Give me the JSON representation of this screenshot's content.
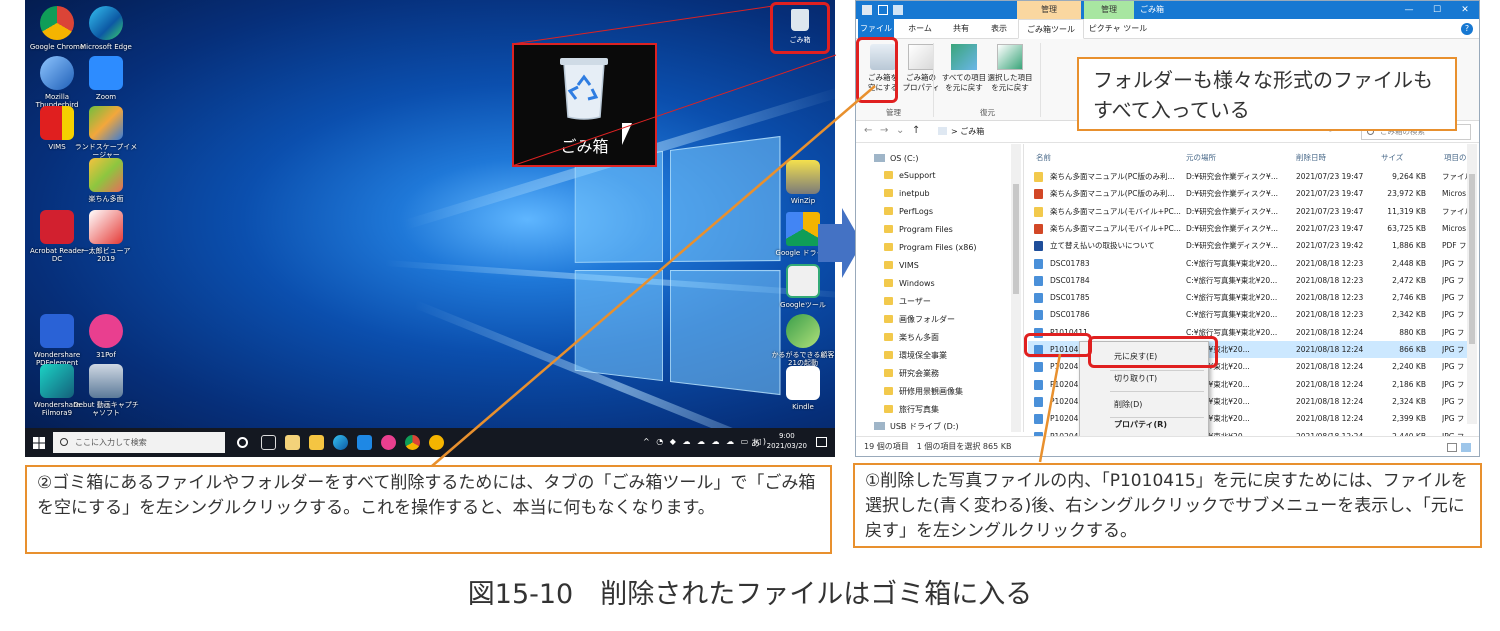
{
  "desktop": {
    "icons": [
      {
        "label": "Google Chrome"
      },
      {
        "label": "Microsoft Edge"
      },
      {
        "label": "Mozilla Thunderbird"
      },
      {
        "label": "Zoom"
      },
      {
        "label": "VIMS"
      },
      {
        "label": "ランドスケープイメージャー"
      },
      {
        "label": "楽ちん多面"
      },
      {
        "label": "Acrobat Reader DC"
      },
      {
        "label": "一太郎ビューア2019"
      },
      {
        "label": "Wondershare PDFelement"
      },
      {
        "label": "31Pof"
      },
      {
        "label": "Wondershare Filmora9"
      },
      {
        "label": "Debut 動画キャプチャソフト"
      },
      {
        "label": "WinZip"
      },
      {
        "label": "Google ドライブ"
      },
      {
        "label": "Googleツール"
      },
      {
        "label": "かるがるできる顧客21の起動"
      },
      {
        "label": "Kindle"
      }
    ],
    "recycle_bin_label": "ごみ箱",
    "zoom_label": "ごみ箱",
    "taskbar": {
      "search_placeholder": "ここに入力して検索",
      "time": "9:00",
      "date": "2021/03/20",
      "ime": "あ"
    }
  },
  "explorer": {
    "titlebar": {
      "context_tab_1": "管理",
      "context_tab_2": "管理",
      "title": "ごみ箱",
      "minimize": "—",
      "maximize": "☐",
      "close": "✕"
    },
    "tabs": [
      "ファイル",
      "ホーム",
      "共有",
      "表示",
      "ごみ箱ツール",
      "ピクチャ ツール"
    ],
    "ribbon": {
      "btn_empty_line1": "ごみ箱を",
      "btn_empty_line2": "空にする",
      "btn_props_line1": "ごみ箱の",
      "btn_props_line2": "プロパティ",
      "btn_restore_all_line1": "すべての項目",
      "btn_restore_all_line2": "を元に戻す",
      "btn_restore_sel_line1": "選択した項目",
      "btn_restore_sel_line2": "を元に戻す",
      "group_manage": "管理",
      "group_restore": "復元"
    },
    "address": {
      "back": "←",
      "forward": "→",
      "recent": "⌄",
      "up": "↑",
      "path": "> ごみ箱",
      "search_placeholder": "ごみ箱の検索"
    },
    "nav_items": [
      "OS (C:)",
      "eSupport",
      "inetpub",
      "PerfLogs",
      "Program Files",
      "Program Files (x86)",
      "VIMS",
      "Windows",
      "ユーザー",
      "画像フォルダー",
      "楽ちん多面",
      "環境保全事業",
      "研究会業務",
      "研修用景観画像集",
      "旅行写真集",
      "USB ドライブ (D:)"
    ],
    "columns": {
      "name": "名前",
      "location": "元の場所",
      "deleted": "削除日時",
      "size": "サイズ",
      "type": "項目の"
    },
    "files": [
      {
        "name": "楽ちん多面マニュアル(PC版のみ利...",
        "loc": "D:¥研究会作業ディスク¥...",
        "date": "2021/07/23 19:47",
        "size": "9,264 KB",
        "type": "ファイル",
        "kind": "folder"
      },
      {
        "name": "楽ちん多面マニュアル(PC版のみ利...",
        "loc": "D:¥研究会作業ディスク¥...",
        "date": "2021/07/23 19:47",
        "size": "23,972 KB",
        "type": "Micros",
        "kind": "ppt"
      },
      {
        "name": "楽ちん多面マニュアル(モバイル+PC...",
        "loc": "D:¥研究会作業ディスク¥...",
        "date": "2021/07/23 19:47",
        "size": "11,319 KB",
        "type": "ファイル",
        "kind": "folder"
      },
      {
        "name": "楽ちん多面マニュアル(モバイル+PC...",
        "loc": "D:¥研究会作業ディスク¥...",
        "date": "2021/07/23 19:47",
        "size": "63,725 KB",
        "type": "Micros",
        "kind": "ppt"
      },
      {
        "name": "立て替え払いの取扱いについて",
        "loc": "D:¥研究会作業ディスク¥...",
        "date": "2021/07/23 19:42",
        "size": "1,886 KB",
        "type": "PDF フ",
        "kind": "pdf"
      },
      {
        "name": "DSC01783",
        "loc": "C:¥旅行写真集¥東北¥20...",
        "date": "2021/08/18 12:23",
        "size": "2,448 KB",
        "type": "JPG フ",
        "kind": "jpg"
      },
      {
        "name": "DSC01784",
        "loc": "C:¥旅行写真集¥東北¥20...",
        "date": "2021/08/18 12:23",
        "size": "2,472 KB",
        "type": "JPG フ",
        "kind": "jpg"
      },
      {
        "name": "DSC01785",
        "loc": "C:¥旅行写真集¥東北¥20...",
        "date": "2021/08/18 12:23",
        "size": "2,746 KB",
        "type": "JPG フ",
        "kind": "jpg"
      },
      {
        "name": "DSC01786",
        "loc": "C:¥旅行写真集¥東北¥20...",
        "date": "2021/08/18 12:23",
        "size": "2,342 KB",
        "type": "JPG フ",
        "kind": "jpg"
      },
      {
        "name": "P1010411",
        "loc": "C:¥旅行写真集¥東北¥20...",
        "date": "2021/08/18 12:24",
        "size": "880 KB",
        "type": "JPG フ",
        "kind": "jpg"
      },
      {
        "name": "P1010415",
        "loc": "写真集¥東北¥20...",
        "date": "2021/08/18 12:24",
        "size": "866 KB",
        "type": "JPG フ",
        "kind": "jpg",
        "selected": true
      },
      {
        "name": "P1020456",
        "loc": "写真集¥東北¥20...",
        "date": "2021/08/18 12:24",
        "size": "2,240 KB",
        "type": "JPG フ",
        "kind": "jpg"
      },
      {
        "name": "P1020457",
        "loc": "写真集¥東北¥20...",
        "date": "2021/08/18 12:24",
        "size": "2,186 KB",
        "type": "JPG フ",
        "kind": "jpg"
      },
      {
        "name": "P1020458",
        "loc": "写真集¥東北¥20...",
        "date": "2021/08/18 12:24",
        "size": "2,324 KB",
        "type": "JPG フ",
        "kind": "jpg"
      },
      {
        "name": "P1020459",
        "loc": "写真集¥東北¥20...",
        "date": "2021/08/18 12:24",
        "size": "2,399 KB",
        "type": "JPG フ",
        "kind": "jpg"
      },
      {
        "name": "P1020462",
        "loc": "写真集¥東北¥20...",
        "date": "2021/08/18 12:24",
        "size": "2,440 KB",
        "type": "JPG フ",
        "kind": "jpg"
      }
    ],
    "context_menu": [
      "元に戻す(E)",
      "切り取り(T)",
      "削除(D)",
      "プロパティ(R)"
    ],
    "status": "19 個の項目　1 個の項目を選択 865 KB",
    "callout": "フォルダーも様々な形式のファイルもすべて入っている"
  },
  "captions": {
    "left": "②ゴミ箱にあるファイルやフォルダーをすべて削除するためには、タブの「ごみ箱ツール」で「ごみ箱を空にする」を左シングルクリックする。これを操作すると、本当に何もなくなります。",
    "right": "①削除した写真ファイルの内、「P1010415」を元に戻すためには、ファイルを選択した(青く変わる)後、右シングルクリックでサブメニューを表示し、「元に戻す」を左シングルクリックする。",
    "figure": "図15-10　削除されたファイルはゴミ箱に入る"
  },
  "colors": {
    "accent_blue": "#1778d2",
    "highlight_red": "#e02020",
    "callout_orange": "#e8902e",
    "selection": "#cce8ff"
  }
}
